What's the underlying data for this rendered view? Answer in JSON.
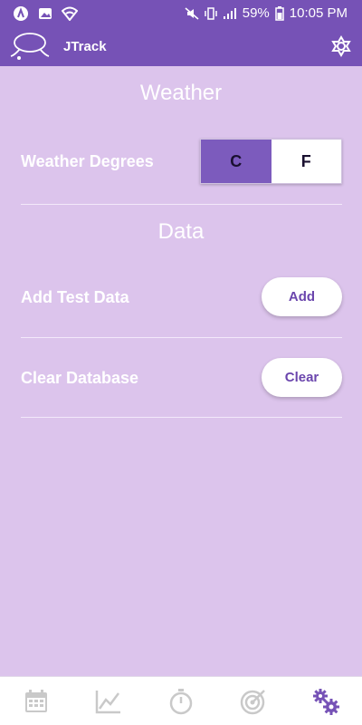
{
  "status_bar": {
    "battery": "59%",
    "time": "10:05 PM",
    "left_icons": [
      "vpn-icon",
      "image-icon",
      "wifi-shield-icon"
    ],
    "right_icons": [
      "mute-icon",
      "vibrate-icon",
      "signal-icon",
      "battery-icon"
    ]
  },
  "app_bar": {
    "title": "JTrack",
    "logo_icon": "lasso-logo-icon",
    "action_icon": "settings-gear-icon"
  },
  "weather": {
    "section_title": "Weather",
    "degrees_label": "Weather Degrees",
    "options": [
      "C",
      "F"
    ],
    "selected": "C"
  },
  "data_section": {
    "section_title": "Data",
    "add_test_label": "Add Test Data",
    "add_button": "Add",
    "clear_db_label": "Clear Database",
    "clear_button": "Clear"
  },
  "bottom_nav": {
    "items": [
      "calendar-icon",
      "chart-icon",
      "stopwatch-icon",
      "target-icon",
      "settings-icon"
    ],
    "active": "settings-icon"
  },
  "colors": {
    "primary": "#7652b6",
    "background": "#dcc4ec",
    "accent_text": "#6b46ad",
    "inactive_nav": "#c9c9c9"
  }
}
